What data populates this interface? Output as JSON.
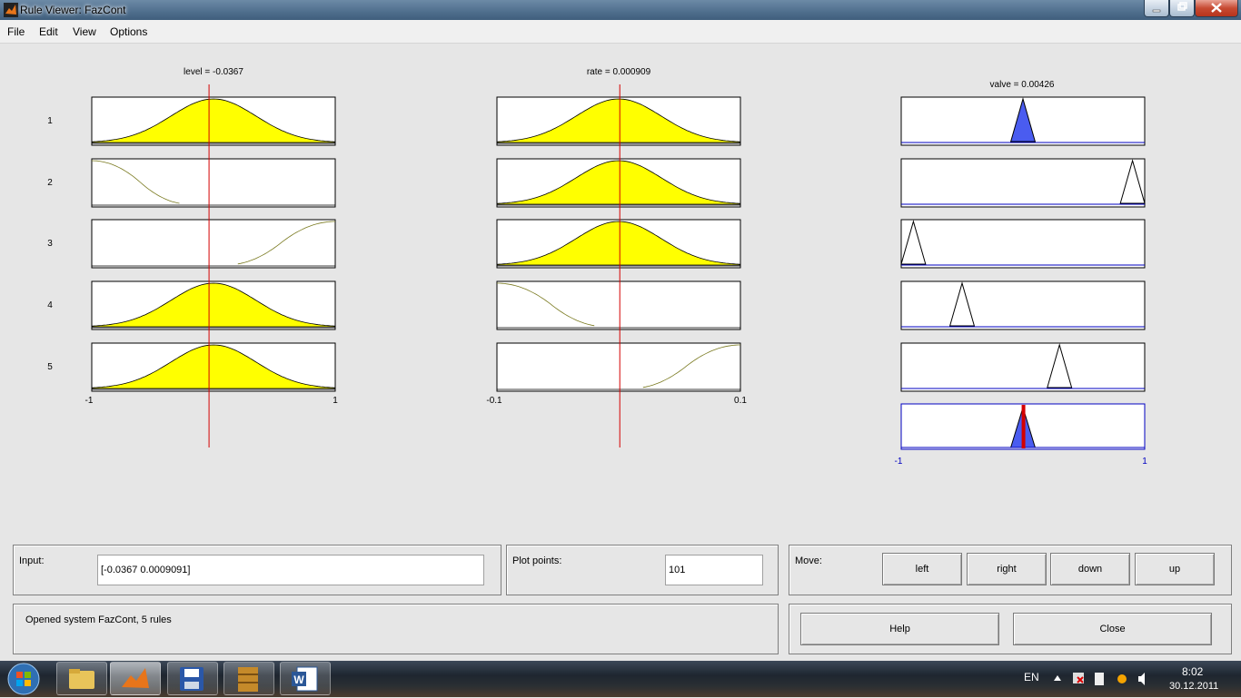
{
  "window": {
    "title": "Rule Viewer: FazCont"
  },
  "menu": [
    "File",
    "Edit",
    "View",
    "Options"
  ],
  "inputs": [
    {
      "title": "level = -0.0367",
      "min_label": "-1",
      "max_label": "1",
      "range": [
        -1,
        1
      ],
      "value": -0.0367,
      "mfs": [
        {
          "shape": "gauss",
          "mean": 0,
          "sigma": 0.35,
          "fired": true
        },
        {
          "shape": "zmf",
          "a": -1,
          "b": -0.2,
          "fired": false
        },
        {
          "shape": "smf",
          "a": 0.1,
          "b": 1,
          "fired": false
        },
        {
          "shape": "gauss",
          "mean": 0,
          "sigma": 0.35,
          "fired": true
        },
        {
          "shape": "gauss",
          "mean": 0,
          "sigma": 0.35,
          "fired": true
        }
      ]
    },
    {
      "title": "rate = 0.000909",
      "min_label": "-0.1",
      "max_label": "0.1",
      "range": [
        -0.1,
        0.1
      ],
      "value": 0.000909,
      "mfs": [
        {
          "shape": "gauss",
          "mean": 0,
          "sigma": 0.035,
          "fired": true
        },
        {
          "shape": "gauss",
          "mean": 0,
          "sigma": 0.035,
          "fired": true
        },
        {
          "shape": "gauss",
          "mean": 0,
          "sigma": 0.035,
          "fired": true
        },
        {
          "shape": "zmf",
          "a": -0.1,
          "b": -0.01,
          "fired": false
        },
        {
          "shape": "smf",
          "a": 0.01,
          "b": 0.1,
          "fired": false
        }
      ]
    }
  ],
  "output": {
    "title": "valve = 0.00426",
    "min_label": "-1",
    "max_label": "1",
    "range": [
      -1,
      1
    ],
    "value": 0.00426,
    "mfs": [
      {
        "peak": 0,
        "half": 0.1,
        "fired": true
      },
      {
        "peak": 0.9,
        "half": 0.1,
        "fired": false
      },
      {
        "peak": -0.9,
        "half": 0.1,
        "fired": false
      },
      {
        "peak": -0.5,
        "half": 0.1,
        "fired": false
      },
      {
        "peak": 0.3,
        "half": 0.1,
        "fired": false
      }
    ]
  },
  "rule_numbers": [
    "1",
    "2",
    "3",
    "4",
    "5"
  ],
  "controls": {
    "input_label": "Input:",
    "input_value": "[-0.0367 0.0009091]",
    "plot_points_label": "Plot points:",
    "plot_points_value": "101",
    "move_label": "Move:",
    "move_buttons": [
      "left",
      "right",
      "down",
      "up"
    ],
    "status": "Opened system FazCont, 5 rules",
    "help_label": "Help",
    "close_label": "Close"
  },
  "taskbar": {
    "language": "EN",
    "time": "8:02",
    "date": "30.12.2011"
  },
  "colors": {
    "fill": "#ffff00",
    "output_fill": "#4a5cf0",
    "indicator": "#d40000",
    "curve": "#7a7a20"
  },
  "icons": [
    "matlab-icon",
    "minimize-icon",
    "maximize-icon",
    "close-icon",
    "windows-start-icon",
    "explorer-folder-icon",
    "matlab-taskbar-icon",
    "save-disk-icon",
    "archive-icon",
    "word-icon"
  ]
}
